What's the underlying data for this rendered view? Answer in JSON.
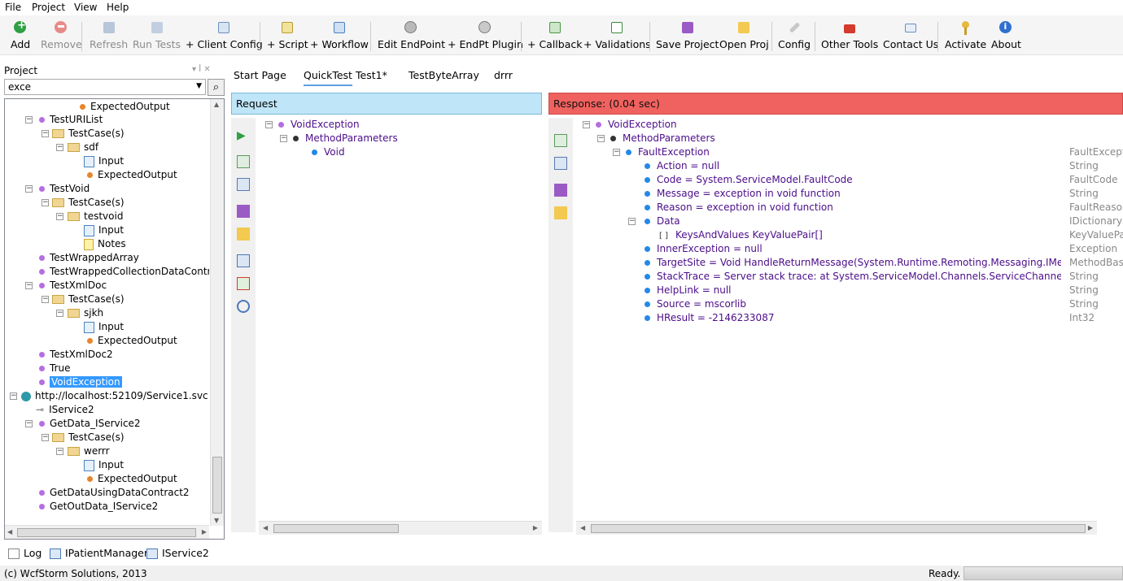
{
  "menu": [
    "File",
    "Project",
    "View",
    "Help"
  ],
  "toolbar": {
    "buttons": [
      {
        "label": "Add",
        "icon": "add-icon",
        "enabled": true
      },
      {
        "label": "Remove",
        "icon": "remove-icon",
        "enabled": false
      },
      {
        "label": "Refresh",
        "icon": "refresh-icon",
        "enabled": false
      },
      {
        "label": "Run Tests",
        "icon": "run-tests-icon",
        "enabled": false
      },
      {
        "label": "+ Client Config",
        "icon": "client-config-icon",
        "enabled": true
      },
      {
        "label": "+ Script",
        "icon": "script-icon",
        "enabled": true
      },
      {
        "label": "+ Workflow",
        "icon": "workflow-icon",
        "enabled": true
      },
      {
        "label": "Edit EndPoint",
        "icon": "edit-endpoint-icon",
        "enabled": true
      },
      {
        "label": "+ EndPt Plugin",
        "icon": "endpoint-plugin-icon",
        "enabled": true
      },
      {
        "label": "+ Callback",
        "icon": "callback-icon",
        "enabled": true
      },
      {
        "label": "+ Validations",
        "icon": "validations-icon",
        "enabled": true
      },
      {
        "label": "Save Project",
        "icon": "save-project-icon",
        "enabled": true
      },
      {
        "label": "Open Proj",
        "icon": "open-project-icon",
        "enabled": true
      },
      {
        "label": "Config",
        "icon": "config-icon",
        "enabled": true
      },
      {
        "label": "Other Tools",
        "icon": "toolbox-icon",
        "enabled": true
      },
      {
        "label": "Contact Us",
        "icon": "mail-icon",
        "enabled": true
      },
      {
        "label": "Activate",
        "icon": "key-icon",
        "enabled": true
      },
      {
        "label": "About",
        "icon": "info-icon",
        "enabled": true
      }
    ]
  },
  "project_panel": {
    "title": "Project",
    "search_value": "exce",
    "tree": [
      {
        "label": "ExpectedOutput",
        "icon": "orange-dot"
      },
      {
        "label": "TestURIList",
        "icon": "purple-dot"
      },
      {
        "label": "TestCase(s)",
        "icon": "folder"
      },
      {
        "label": "sdf",
        "icon": "folder-doc"
      },
      {
        "label": "Input",
        "icon": "doc"
      },
      {
        "label": "ExpectedOutput",
        "icon": "orange-dot"
      },
      {
        "label": "TestVoid",
        "icon": "purple-dot"
      },
      {
        "label": "TestCase(s)",
        "icon": "folder"
      },
      {
        "label": "testvoid",
        "icon": "folder-doc"
      },
      {
        "label": "Input",
        "icon": "doc"
      },
      {
        "label": "Notes",
        "icon": "note"
      },
      {
        "label": "TestWrappedArray",
        "icon": "purple-dot"
      },
      {
        "label": "TestWrappedCollectionDataContrac",
        "icon": "purple-dot"
      },
      {
        "label": "TestXmlDoc",
        "icon": "purple-dot"
      },
      {
        "label": "TestCase(s)",
        "icon": "folder"
      },
      {
        "label": "sjkh",
        "icon": "folder-doc"
      },
      {
        "label": "Input",
        "icon": "doc"
      },
      {
        "label": "ExpectedOutput",
        "icon": "orange-dot"
      },
      {
        "label": "TestXmlDoc2",
        "icon": "purple-dot"
      },
      {
        "label": "True",
        "icon": "purple-dot"
      },
      {
        "label": "VoidException",
        "icon": "purple-dot",
        "selected": true
      },
      {
        "label": "http://localhost:52109/Service1.svc",
        "icon": "globe"
      },
      {
        "label": "IService2",
        "icon": "interface"
      },
      {
        "label": "GetData_IService2",
        "icon": "purple-dot"
      },
      {
        "label": "TestCase(s)",
        "icon": "folder"
      },
      {
        "label": "werrr",
        "icon": "folder-doc"
      },
      {
        "label": "Input",
        "icon": "doc"
      },
      {
        "label": "ExpectedOutput",
        "icon": "orange-dot"
      },
      {
        "label": "GetDataUsingDataContract2",
        "icon": "purple-dot"
      },
      {
        "label": "GetOutData_IService2",
        "icon": "purple-dot"
      }
    ]
  },
  "tabs": [
    {
      "label": "Start Page",
      "active": false
    },
    {
      "label": "QuickTest",
      "active": true
    },
    {
      "label": "Test1*",
      "active": false
    },
    {
      "label": "TestByteArray",
      "active": false
    },
    {
      "label": "drrr",
      "active": false
    }
  ],
  "request": {
    "header": "Request",
    "tree": [
      {
        "label": "VoidException"
      },
      {
        "label": "MethodParameters"
      },
      {
        "label": "Void"
      }
    ]
  },
  "response": {
    "header": "Response: (0.04 sec)",
    "tree": [
      {
        "label": "VoidException",
        "type": ""
      },
      {
        "label": "MethodParameters",
        "type": ""
      },
      {
        "label": "FaultException",
        "type": "FaultException"
      },
      {
        "label": "Action = null",
        "type": "String"
      },
      {
        "label": "Code = System.ServiceModel.FaultCode",
        "type": "FaultCode"
      },
      {
        "label": "Message = exception in void function",
        "type": "String"
      },
      {
        "label": "Reason = exception in void function",
        "type": "FaultReason"
      },
      {
        "label": "Data",
        "type": "IDictionary"
      },
      {
        "label": "KeysAndValues KeyValuePair[]",
        "type": "KeyValuePair"
      },
      {
        "label": "InnerException = null",
        "type": "Exception"
      },
      {
        "label": "TargetSite = Void HandleReturnMessage(System.Runtime.Remoting.Messaging.IMessage, Sys",
        "type": "MethodBase"
      },
      {
        "label": "StackTrace = Server stack trace:    at System.ServiceModel.Channels.ServiceChannel.HandleRe",
        "type": "String"
      },
      {
        "label": "HelpLink = null",
        "type": "String"
      },
      {
        "label": "Source = mscorlib",
        "type": "String"
      },
      {
        "label": "HResult = -2146233087",
        "type": "Int32"
      }
    ]
  },
  "bottom_tabs": [
    "Log",
    "IPatientManager",
    "IService2"
  ],
  "status": {
    "copyright": "(c) WcfStorm Solutions, 2013",
    "state": "Ready."
  }
}
